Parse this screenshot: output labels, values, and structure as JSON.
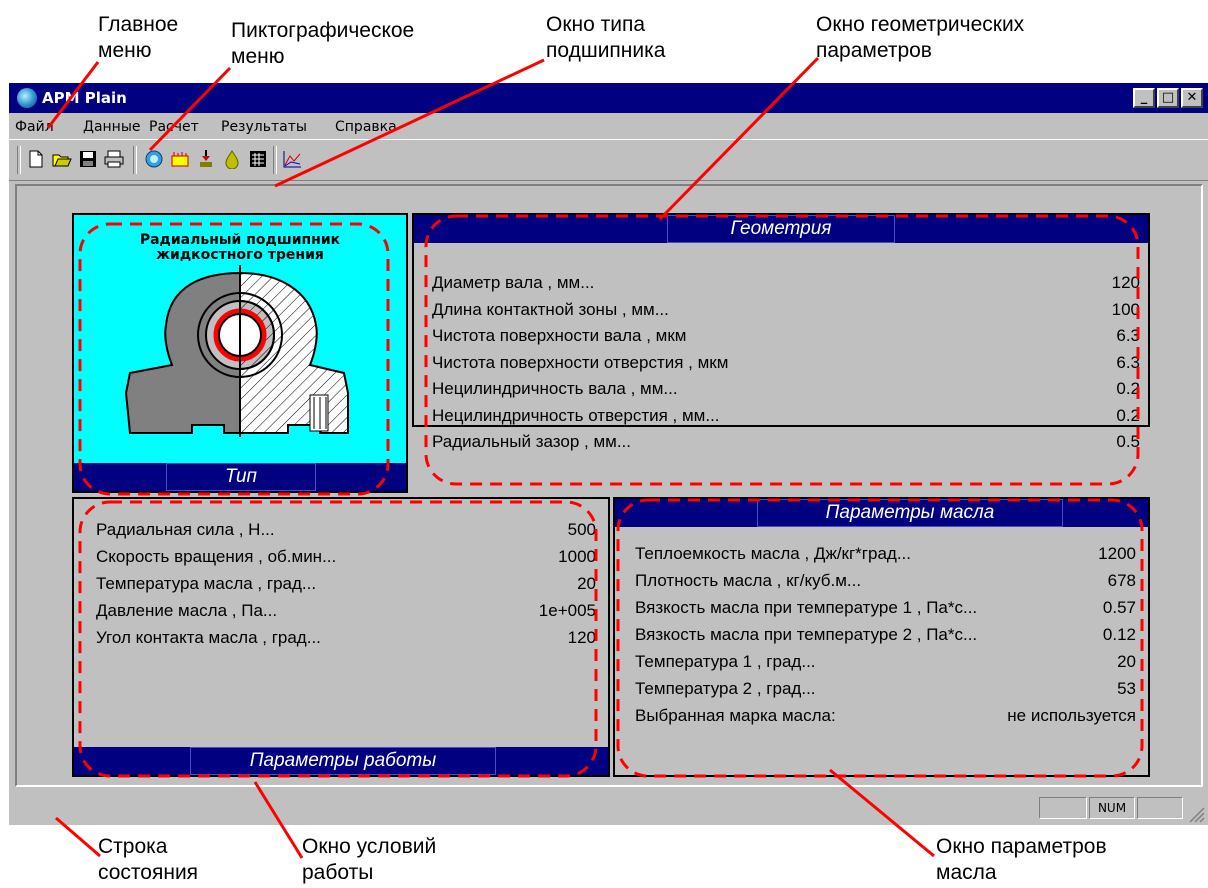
{
  "annotations": {
    "main_menu": "Главное\nменю",
    "icon_menu": "Пиктографическое\nменю",
    "bearing_type_window": "Окно типа\nподшипника",
    "geometry_window": "Окно геометрических\nпараметров",
    "status_bar": "Строка\nсостояния",
    "work_conditions_window": "Окно условий\nработы",
    "oil_params_window": "Окно параметров\nмасла"
  },
  "app": {
    "title": "APM Plain"
  },
  "menu": [
    "Файл",
    "Данные",
    "Расчет",
    "Результаты",
    "Справка"
  ],
  "toolbar_icons": [
    "new-file-icon",
    "open-folder-icon",
    "save-disk-icon",
    "print-icon",
    "bearing-type-icon",
    "geometry-icon",
    "load-icon",
    "oil-icon",
    "calculator-icon",
    "graph-icon"
  ],
  "type_panel": {
    "caption": "Радиальный подшипник\nжидкостного трения",
    "title": "Тип"
  },
  "geometry": {
    "title": "Геометрия",
    "rows": [
      {
        "label": "Диаметр вала , мм...",
        "value": "120"
      },
      {
        "label": "Длина контактной зоны , мм...",
        "value": "100"
      },
      {
        "label": "Чистота поверхности вала , мкм",
        "value": "6.3"
      },
      {
        "label": "Чистота поверхности отверстия , мкм",
        "value": "6.3"
      },
      {
        "label": "Нецилиндричность вала , мм...",
        "value": "0.2"
      },
      {
        "label": "Нецилиндричность отверстия , мм...",
        "value": "0.2"
      },
      {
        "label": "Радиальный зазор , мм...",
        "value": "0.5"
      }
    ]
  },
  "work": {
    "title": "Параметры работы",
    "rows": [
      {
        "label": "Радиальная сила , Н...",
        "value": "500"
      },
      {
        "label": "Скорость вращения , об.мин...",
        "value": "1000"
      },
      {
        "label": "Температура масла , град...",
        "value": "20"
      },
      {
        "label": "Давление масла , Па...",
        "value": "1e+005"
      },
      {
        "label": "Угол контакта масла , град...",
        "value": "120"
      }
    ]
  },
  "oil": {
    "title": "Параметры масла",
    "rows": [
      {
        "label": "Теплоемкость масла , Дж/кг*град...",
        "value": "1200"
      },
      {
        "label": "Плотность масла , кг/куб.м...",
        "value": "678"
      },
      {
        "label": "Вязкость масла при температуре 1 , Па*с...",
        "value": "0.57"
      },
      {
        "label": "Вязкость масла при температуре 2 , Па*с...",
        "value": "0.12"
      },
      {
        "label": "Температура 1 , град...",
        "value": "20"
      },
      {
        "label": "Температура 2 , град...",
        "value": "53"
      },
      {
        "label": "Выбранная марка масла:",
        "value": "не используется"
      }
    ]
  },
  "status": {
    "num": "NUM"
  },
  "colors": {
    "accent_red": "#ff0000",
    "panel_cyan": "#00ffff",
    "title_navy": "#000080"
  }
}
